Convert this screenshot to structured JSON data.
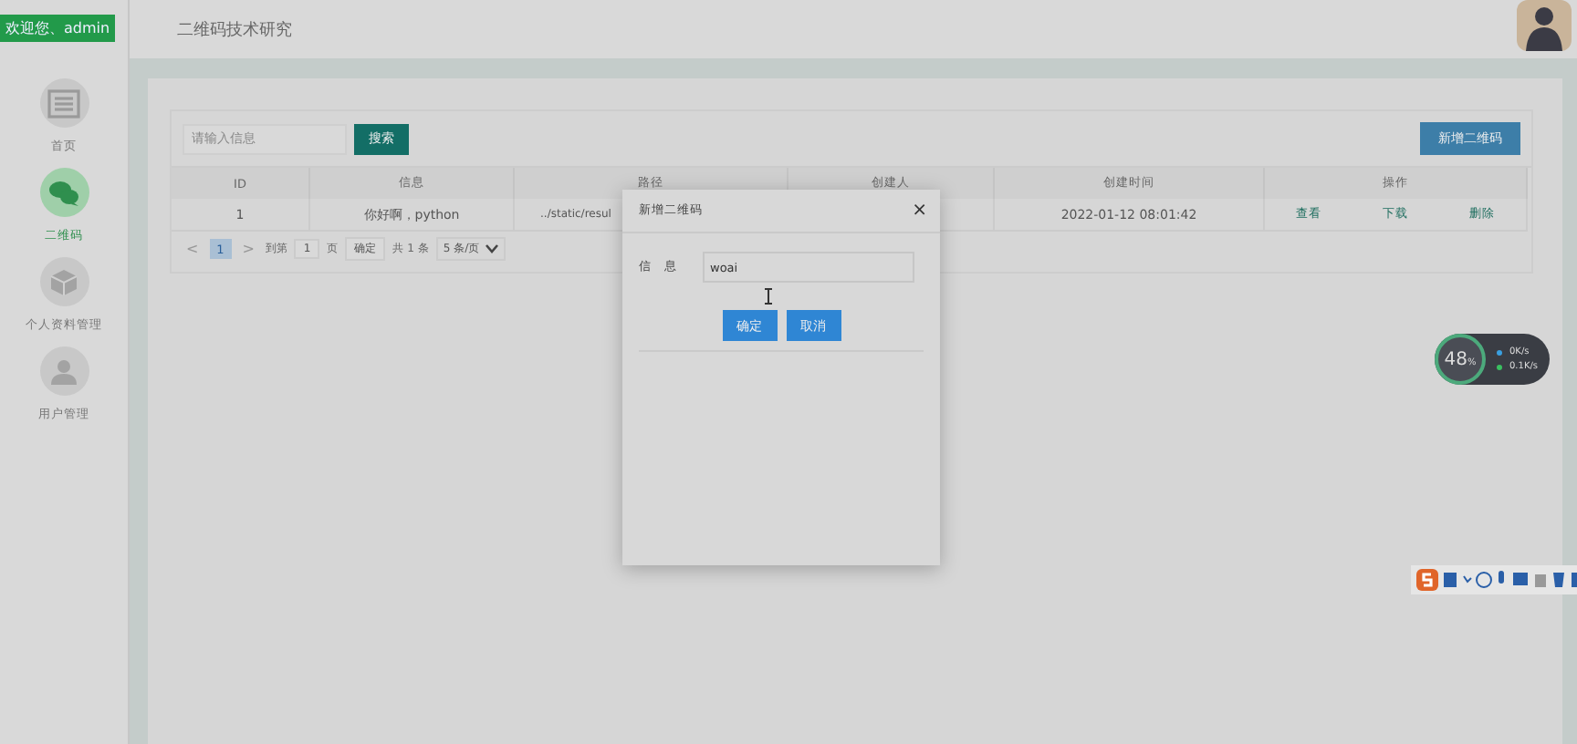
{
  "sidebar": {
    "welcome": "欢迎您、admin",
    "items": [
      {
        "label": "首页",
        "selected": false
      },
      {
        "label": "二维码",
        "selected": true
      },
      {
        "label": "个人资料管理",
        "selected": false
      },
      {
        "label": "用户管理",
        "selected": false
      }
    ]
  },
  "header": {
    "title": "二维码技术研究"
  },
  "toolbar": {
    "search_placeholder": "请输入信息",
    "search_button": "搜索",
    "add_button": "新增二维码"
  },
  "table": {
    "columns": [
      "ID",
      "信息",
      "路径",
      "创建人",
      "创建时间",
      "操作"
    ],
    "rows": [
      {
        "cells": [
          "1",
          "你好啊，python",
          "../static/resul",
          "",
          "2022-01-12 08:01:42"
        ],
        "actions": [
          "查看",
          "下载",
          "删除"
        ]
      }
    ]
  },
  "pager": {
    "prev": "<",
    "pages": [
      {
        "label": "1",
        "selected": true
      }
    ],
    "next": ">",
    "goto": "到第",
    "page_input": "1",
    "page_unit": "页",
    "confirm": "确定",
    "total": "共 1 条",
    "per_page": "5 条/页"
  },
  "dialog": {
    "title": "新增二维码",
    "close": "×",
    "field_label": "信　息",
    "field_value": "woai",
    "buttons": [
      "确定",
      "取消"
    ]
  },
  "net_widget": {
    "percent": "48",
    "unit": "%",
    "upload": "0K/s",
    "download": "0.1K/s"
  }
}
